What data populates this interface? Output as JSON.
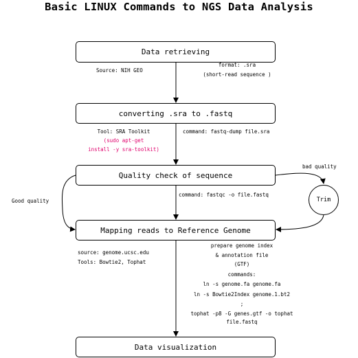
{
  "title": "Basic LINUX Commands to NGS Data Analysis",
  "boxes": {
    "retrieve": "Data retrieving",
    "convert": "converting .sra to .fastq",
    "quality": "Quality check of sequence",
    "mapping": "Mapping reads to Reference Genome",
    "visual": "Data visualization",
    "trim": "Trim"
  },
  "labels": {
    "source_geo": "Source: NIH GEO",
    "format_line1": "format: .sra",
    "format_line2": "(short-read sequence )",
    "tool": "Tool: SRA Toolkit",
    "sudo_line1": "(sudo apt-get",
    "sudo_line2": "install -y sra-toolkit)",
    "command_fastq": "command: fastq-dump file.sra",
    "bad_quality": "bad quality",
    "good_quality": "Good quality",
    "command_fastqc": "command:  fastqc -o file.fastq",
    "source_ucsc": "source: genome.ucsc.edu",
    "tools_bowtie": "Tools: Bowtie2, Tophat",
    "prep_line1": "prepare genome index",
    "prep_line2": "& annotation file",
    "prep_line3": "(GTF)",
    "commands": "commands:",
    "cmd1": "ln -s genome.fa genome.fa",
    "cmd2": "ln -s Bowtie2Index genome.1.bt2",
    "semicolon": ";",
    "cmd3": "tophat -p8 -G genes.gtf -o tophat",
    "cmd4": "file.fastq"
  }
}
